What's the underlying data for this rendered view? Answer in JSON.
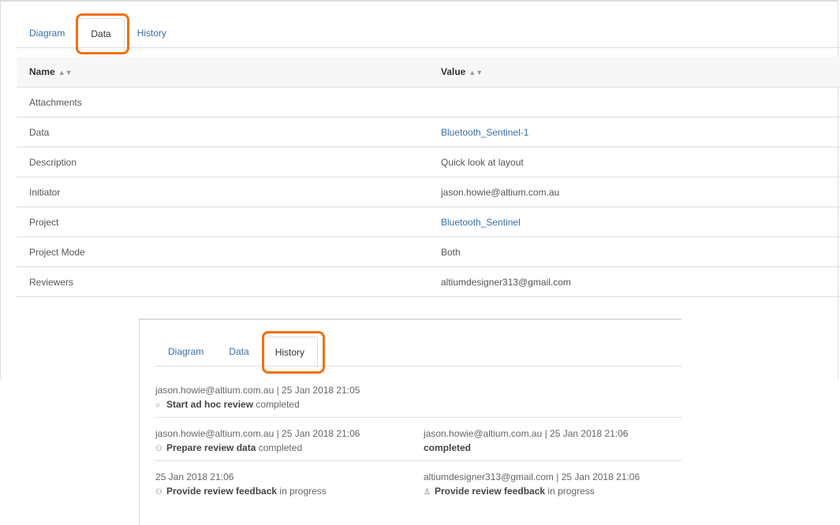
{
  "top": {
    "tabs": [
      "Diagram",
      "Data",
      "History"
    ],
    "active": "Data",
    "columns": [
      "Name",
      "Value"
    ],
    "rows": [
      {
        "name": "Attachments",
        "value": "",
        "link": false
      },
      {
        "name": "Data",
        "value": "Bluetooth_Sentinel-1",
        "link": true
      },
      {
        "name": "Description",
        "value": "Quick look at layout",
        "link": false
      },
      {
        "name": "Initiator",
        "value": "jason.howie@altium.com.au",
        "link": false
      },
      {
        "name": "Project",
        "value": "Bluetooth_Sentinel",
        "link": true
      },
      {
        "name": "Project Mode",
        "value": "Both",
        "link": false
      },
      {
        "name": "Reviewers",
        "value": "altiumdesigner313@gmail.com",
        "link": false
      }
    ]
  },
  "bottom": {
    "tabs": [
      "Diagram",
      "Data",
      "History"
    ],
    "active": "History",
    "entries": [
      {
        "meta": "jason.howie@altium.com.au | 25 Jan 2018 21:05",
        "icon": "circle-icon",
        "task": "Start ad hoc review",
        "status": "completed"
      },
      {
        "meta": "jason.howie@altium.com.au | 25 Jan 2018 21:06",
        "icon": "user-check-icon",
        "task": "Prepare review data",
        "status": "completed"
      },
      {
        "meta": "jason.howie@altium.com.au | 25 Jan 2018 21:06",
        "icon": "",
        "task": "",
        "status": "completed"
      },
      {
        "meta": "25 Jan 2018 21:06",
        "icon": "users-icon",
        "task": "Provide review feedback",
        "status": "in progress"
      },
      {
        "meta": "altiumdesigner313@gmail.com | 25 Jan 2018 21:06",
        "icon": "user-icon",
        "task": "Provide review feedback",
        "status": "in progress"
      }
    ]
  },
  "highlight_color": "#f07010"
}
